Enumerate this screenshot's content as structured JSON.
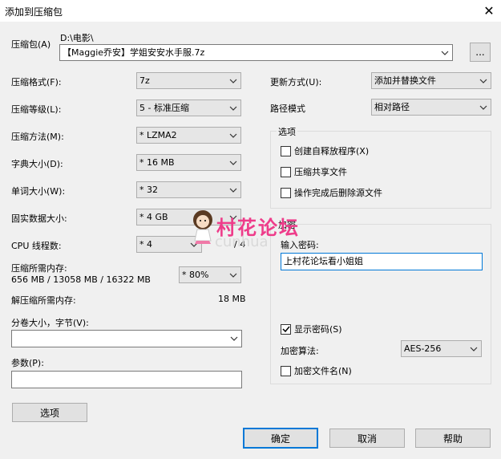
{
  "window": {
    "title": "添加到压缩包"
  },
  "archive": {
    "label": "压缩包(A)",
    "path": "D:\\电影\\",
    "name": "【Maggie乔安】学姐安安水手服.7z",
    "browse_label": "..."
  },
  "left": {
    "format": {
      "label": "压缩格式(F):",
      "value": "7z"
    },
    "level": {
      "label": "压缩等级(L):",
      "value": "5 - 标准压缩"
    },
    "method": {
      "label": "压缩方法(M):",
      "value": "* LZMA2"
    },
    "dict": {
      "label": "字典大小(D):",
      "value": "* 16 MB"
    },
    "word": {
      "label": "单词大小(W):",
      "value": "* 32"
    },
    "solid": {
      "label": "固实数据大小:",
      "value": "* 4 GB"
    },
    "cpu": {
      "label": "CPU 线程数:",
      "value": "* 4",
      "total": "/ 4"
    },
    "mem_comp": {
      "label": "压缩所需内存:",
      "value": "656 MB / 13058 MB / 16322 MB",
      "percent": "* 80%"
    },
    "mem_decomp": {
      "label": "解压缩所需内存:",
      "value": "18 MB"
    },
    "volume": {
      "label": "分卷大小，字节(V):",
      "value": ""
    },
    "params": {
      "label": "参数(P):",
      "value": ""
    },
    "options_button": "选项"
  },
  "right": {
    "update": {
      "label": "更新方式(U):",
      "value": "添加并替换文件"
    },
    "path_mode": {
      "label": "路径模式",
      "value": "相对路径"
    },
    "options_group": {
      "title": "选项",
      "sfx": "创建自释放程序(X)",
      "shared": "压缩共享文件",
      "delete": "操作完成后删除源文件"
    },
    "encryption_group": {
      "title": "加密",
      "password_label": "输入密码:",
      "password_value": "上村花论坛看小姐姐",
      "show_password": "显示密码(S)",
      "method_label": "加密算法:",
      "method_value": "AES-256",
      "encrypt_names": "加密文件名(N)"
    }
  },
  "buttons": {
    "ok": "确定",
    "cancel": "取消",
    "help": "帮助"
  },
  "watermark": {
    "text": "村花论坛",
    "sub": "cunhua"
  }
}
